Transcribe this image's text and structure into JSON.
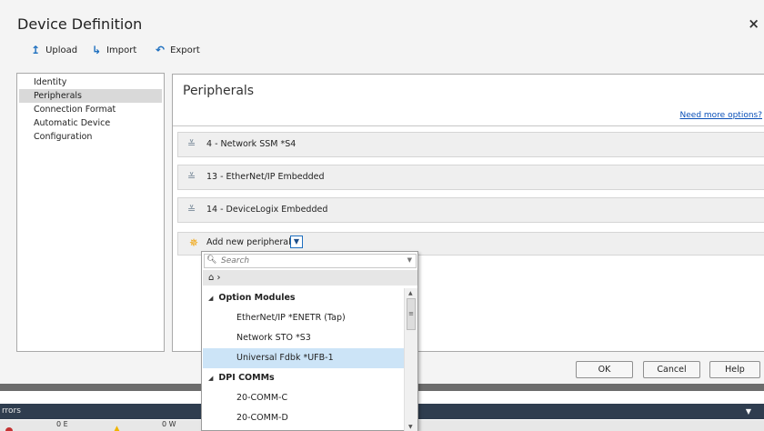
{
  "dialog": {
    "title": "Device Definition",
    "close": "×"
  },
  "toolbar": {
    "upload": {
      "label": "Upload",
      "icon": "upload-icon",
      "glyph": "↥"
    },
    "import": {
      "label": "Import",
      "icon": "import-icon",
      "glyph": "↳"
    },
    "export": {
      "label": "Export",
      "icon": "export-icon",
      "glyph": "↶"
    }
  },
  "nav": {
    "items": [
      {
        "label": "Identity"
      },
      {
        "label": "Peripherals",
        "selected": true
      },
      {
        "label": "Connection Format"
      },
      {
        "label": "Automatic Device Configuration"
      }
    ]
  },
  "main": {
    "title": "Peripherals",
    "need_more_options": "Need more options?",
    "peripherals": [
      {
        "label": "4 - Network SSM *S4"
      },
      {
        "label": "13 - EtherNet/IP Embedded"
      },
      {
        "label": "14 - DeviceLogix Embedded"
      }
    ],
    "add_new": {
      "label": "Add new peripheral",
      "icon": "star-icon"
    }
  },
  "popup": {
    "search_placeholder": "Search",
    "breadcrumb": "⌂ ›",
    "groups": [
      {
        "label": "Option Modules",
        "items": [
          {
            "label": "EtherNet/IP *ENETR (Tap)"
          },
          {
            "label": "Network STO *S3"
          },
          {
            "label": "Universal Fdbk *UFB-1",
            "selected": true
          }
        ]
      },
      {
        "label": "DPI COMMs",
        "items": [
          {
            "label": "20-COMM-C"
          },
          {
            "label": "20-COMM-D"
          }
        ]
      }
    ]
  },
  "buttons": {
    "ok": "OK",
    "cancel": "Cancel",
    "help": "Help"
  },
  "errors": {
    "title": "rrors",
    "count_errors": "0 E",
    "count_warnings": "0 W"
  },
  "colors": {
    "selection": "#cce4f7",
    "link": "#0a50b8",
    "error_header": "#2f3d4f"
  }
}
